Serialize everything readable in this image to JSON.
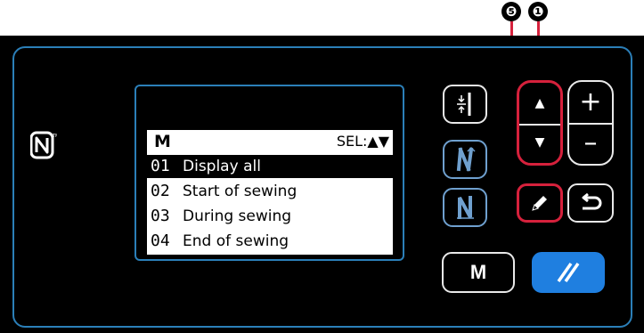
{
  "callouts": {
    "callout_5": "❺",
    "callout_1": "❶"
  },
  "nfc_mark": "N",
  "screen": {
    "title": "M",
    "sel_label": "SEL:▲▼",
    "rows": [
      {
        "num": "01",
        "label": "Display all",
        "selected": true
      },
      {
        "num": "02",
        "label": "Start of sewing",
        "selected": false
      },
      {
        "num": "03",
        "label": "During sewing",
        "selected": false
      },
      {
        "num": "04",
        "label": "End of sewing",
        "selected": false
      }
    ]
  },
  "buttons": {
    "m_label": "M",
    "plus_label": "+",
    "minus_label": "–",
    "up_label": "▲",
    "down_label": "▼"
  },
  "colors": {
    "frame": "#2b7fb8",
    "reset_button": "#1f7fe0",
    "callout_highlight": "#d6213c"
  },
  "icons": [
    "nfc-icon",
    "threading-icon",
    "reverse-stitch-icon",
    "needle-stitch-icon",
    "pencil-icon",
    "return-icon",
    "reset-icon"
  ]
}
